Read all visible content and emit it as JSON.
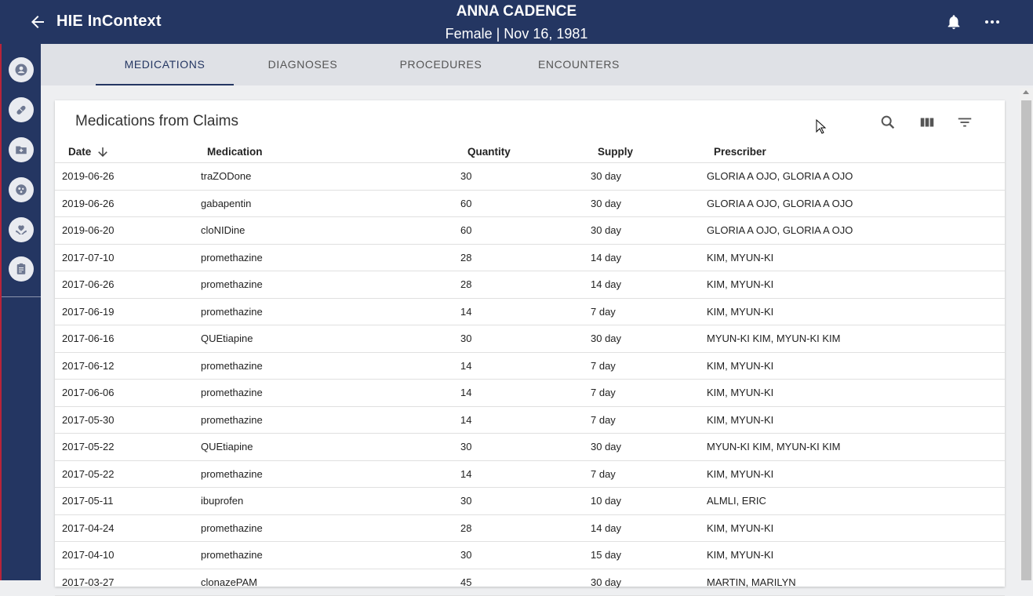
{
  "header": {
    "app_title": "HIE InContext",
    "patient_name": "ANNA CADENCE",
    "patient_info": "Female | Nov 16, 1981"
  },
  "sidebar": {
    "items": [
      {
        "icon": "account-circle-icon"
      },
      {
        "icon": "pill-icon"
      },
      {
        "icon": "folder-add-icon"
      },
      {
        "icon": "virus-icon"
      },
      {
        "icon": "heart-hands-icon"
      },
      {
        "icon": "clipboard-icon"
      }
    ]
  },
  "tabs": [
    {
      "label": "MEDICATIONS",
      "active": true
    },
    {
      "label": "DIAGNOSES",
      "active": false
    },
    {
      "label": "PROCEDURES",
      "active": false
    },
    {
      "label": "ENCOUNTERS",
      "active": false
    }
  ],
  "card": {
    "title": "Medications from Claims",
    "columns": [
      "Date",
      "Medication",
      "Quantity",
      "Supply",
      "Prescriber"
    ],
    "rows": [
      [
        "2019-06-26",
        "traZODone",
        "30",
        "30 day",
        "GLORIA A OJO, GLORIA A OJO"
      ],
      [
        "2019-06-26",
        "gabapentin",
        "60",
        "30 day",
        "GLORIA A OJO, GLORIA A OJO"
      ],
      [
        "2019-06-20",
        "cloNIDine",
        "60",
        "30 day",
        "GLORIA A OJO, GLORIA A OJO"
      ],
      [
        "2017-07-10",
        "promethazine",
        "28",
        "14 day",
        "KIM, MYUN-KI"
      ],
      [
        "2017-06-26",
        "promethazine",
        "28",
        "14 day",
        "KIM, MYUN-KI"
      ],
      [
        "2017-06-19",
        "promethazine",
        "14",
        "7 day",
        "KIM, MYUN-KI"
      ],
      [
        "2017-06-16",
        "QUEtiapine",
        "30",
        "30 day",
        "MYUN-KI KIM, MYUN-KI KIM"
      ],
      [
        "2017-06-12",
        "promethazine",
        "14",
        "7 day",
        "KIM, MYUN-KI"
      ],
      [
        "2017-06-06",
        "promethazine",
        "14",
        "7 day",
        "KIM, MYUN-KI"
      ],
      [
        "2017-05-30",
        "promethazine",
        "14",
        "7 day",
        "KIM, MYUN-KI"
      ],
      [
        "2017-05-22",
        "QUEtiapine",
        "30",
        "30 day",
        "MYUN-KI KIM, MYUN-KI KIM"
      ],
      [
        "2017-05-22",
        "promethazine",
        "14",
        "7 day",
        "KIM, MYUN-KI"
      ],
      [
        "2017-05-11",
        "ibuprofen",
        "30",
        "10 day",
        "ALMLI, ERIC"
      ],
      [
        "2017-04-24",
        "promethazine",
        "28",
        "14 day",
        "KIM, MYUN-KI"
      ],
      [
        "2017-04-10",
        "promethazine",
        "30",
        "15 day",
        "KIM, MYUN-KI"
      ],
      [
        "2017-03-27",
        "clonazePAM",
        "45",
        "30 day",
        "MARTIN, MARILYN"
      ]
    ]
  },
  "colors": {
    "header_bg": "#243662",
    "tab_bar_bg": "#dfe1e6",
    "page_bg": "#eeeff1",
    "accent": "#243662"
  }
}
